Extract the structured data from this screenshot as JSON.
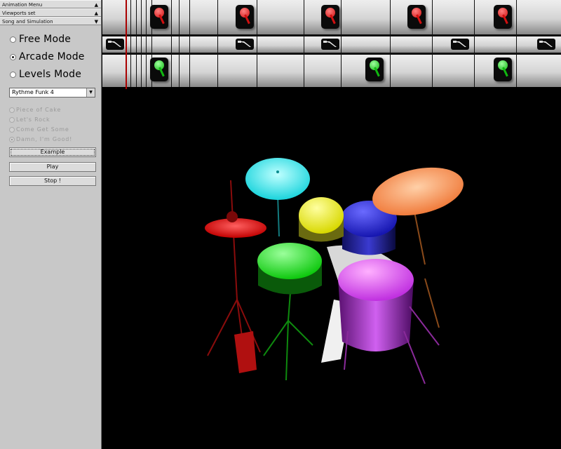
{
  "panel": {
    "rollouts": [
      {
        "label": "Animation Menu",
        "arrow": "▲"
      },
      {
        "label": "Viewports set",
        "arrow": "▲"
      },
      {
        "label": "Song and Simulation",
        "arrow": "▼"
      }
    ],
    "modes": [
      {
        "label": "Free Mode",
        "selected": false
      },
      {
        "label": "Arcade Mode",
        "selected": true
      },
      {
        "label": "Levels Mode",
        "selected": false
      }
    ],
    "song": {
      "selected": "Rythme Funk 4",
      "arrow": "▼"
    },
    "difficulties": [
      {
        "label": "Piece of Cake",
        "selected": false
      },
      {
        "label": "Let's Rock",
        "selected": false
      },
      {
        "label": "Come Get Some",
        "selected": false
      },
      {
        "label": "Damn, I'm Good!",
        "selected": true
      }
    ],
    "buttons": {
      "example": "Example",
      "play": "Play",
      "stop": "Stop !"
    }
  },
  "track": {
    "lanes": [
      {
        "name": "cymbal-lane",
        "color": "#e01818",
        "note_positions": [
          0.125,
          0.31,
          0.497,
          0.684,
          0.872
        ]
      },
      {
        "name": "pedal-lane",
        "note_positions": [
          0.03,
          0.31,
          0.497,
          0.78,
          0.965
        ]
      },
      {
        "name": "tom-lane",
        "color": "#12c820",
        "note_positions": [
          0.125,
          0.59,
          0.872
        ]
      }
    ]
  },
  "scene": {
    "drum_colors": {
      "crash": "#22e8ee",
      "ride": "#ff9a5a",
      "hihat": "#ff1a1a",
      "tom_high": "#ffff22",
      "tom_mid": "#2a2ae8",
      "snare": "#11f011",
      "floor_tom": "#e040ff",
      "kick_pedal": "#ffffff"
    }
  }
}
